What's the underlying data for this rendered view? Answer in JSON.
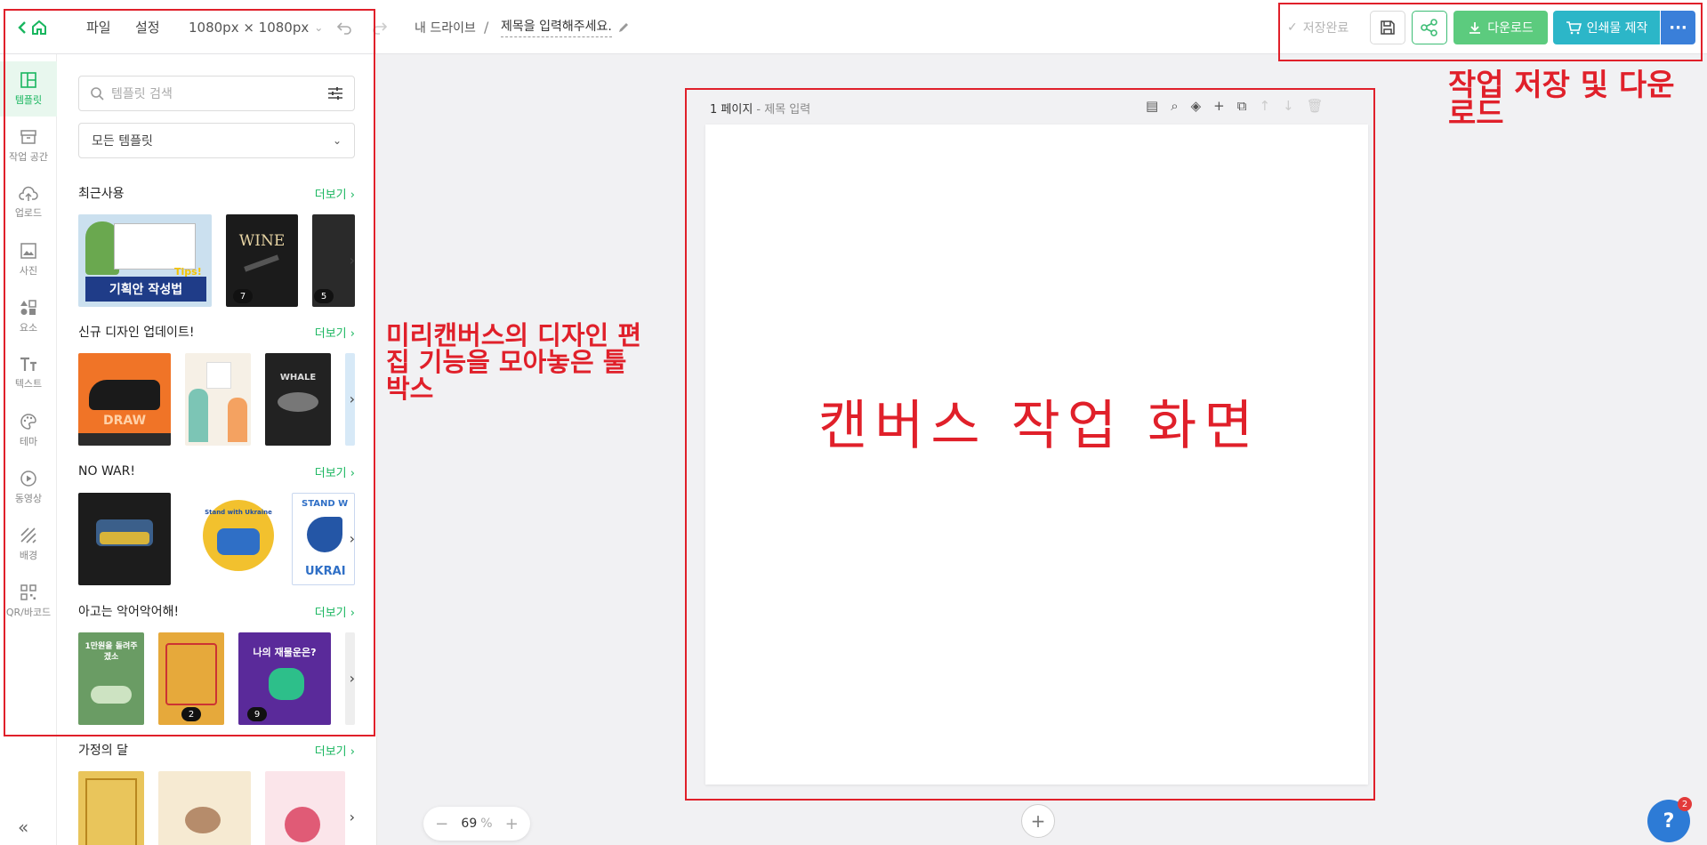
{
  "topbar": {
    "menu_file": "파일",
    "menu_settings": "설정",
    "canvas_size": "1080px × 1080px",
    "drive": "내 드라이브",
    "separator": "/",
    "doc_title": "제목을 입력해주세요.",
    "saved_status": "저장완료",
    "download_label": "다운로드",
    "print_label": "인쇄물 제작",
    "more_label": "···"
  },
  "rail": {
    "items": [
      {
        "label": "템플릿",
        "icon": "template-icon"
      },
      {
        "label": "작업 공간",
        "icon": "workspace-icon"
      },
      {
        "label": "업로드",
        "icon": "upload-icon"
      },
      {
        "label": "사진",
        "icon": "photo-icon"
      },
      {
        "label": "요소",
        "icon": "elements-icon"
      },
      {
        "label": "텍스트",
        "icon": "text-icon"
      },
      {
        "label": "테마",
        "icon": "theme-icon"
      },
      {
        "label": "동영상",
        "icon": "video-icon"
      },
      {
        "label": "배경",
        "icon": "background-icon"
      },
      {
        "label": "QR/바코드",
        "icon": "qr-icon"
      }
    ],
    "collapse": "«"
  },
  "panel": {
    "search_placeholder": "템플릿 검색",
    "filter_value": "모든 템플릿",
    "more_label": "더보기",
    "sections": [
      {
        "title": "최근사용",
        "badges": [
          "7",
          "5"
        ]
      },
      {
        "title": "신규 디자인 업데이트!"
      },
      {
        "title": "NO WAR!"
      },
      {
        "title": "아고는 악어악어해!",
        "badges": [
          "2",
          "9"
        ]
      },
      {
        "title": "가정의 달"
      }
    ],
    "thumb_texts": {
      "recent_1": "기획안 작성법",
      "recent_1_tag": "Tips!",
      "recent_2": "WINE",
      "new_1": "DRAW",
      "new_3": "WHALE",
      "war_3": "STAND W",
      "war_3b": "UKRAI",
      "war_2": "Stand with Ukraine",
      "croc_1": "1만원을 돌려주겠소",
      "croc_3": "나의 재물운은?"
    }
  },
  "canvas": {
    "page_label": "1 페이지",
    "page_sub": " - 제목 입력"
  },
  "zoom": {
    "minus": "−",
    "value": "69",
    "unit": "%",
    "plus": "+"
  },
  "help": {
    "label": "?",
    "badge": "2"
  },
  "annotations": {
    "toolbox": "미리캔버스의 디자인 편집 기능을 모아놓은 툴 박스",
    "save": "작업 저장 및 다운로드",
    "canvas": "캔버스 작업 화면"
  },
  "colors": {
    "accent": "#19b65f",
    "download": "#5ccb7e",
    "print": "#2cb6c8",
    "more": "#3a7fd9",
    "annotation": "#e0202a"
  }
}
